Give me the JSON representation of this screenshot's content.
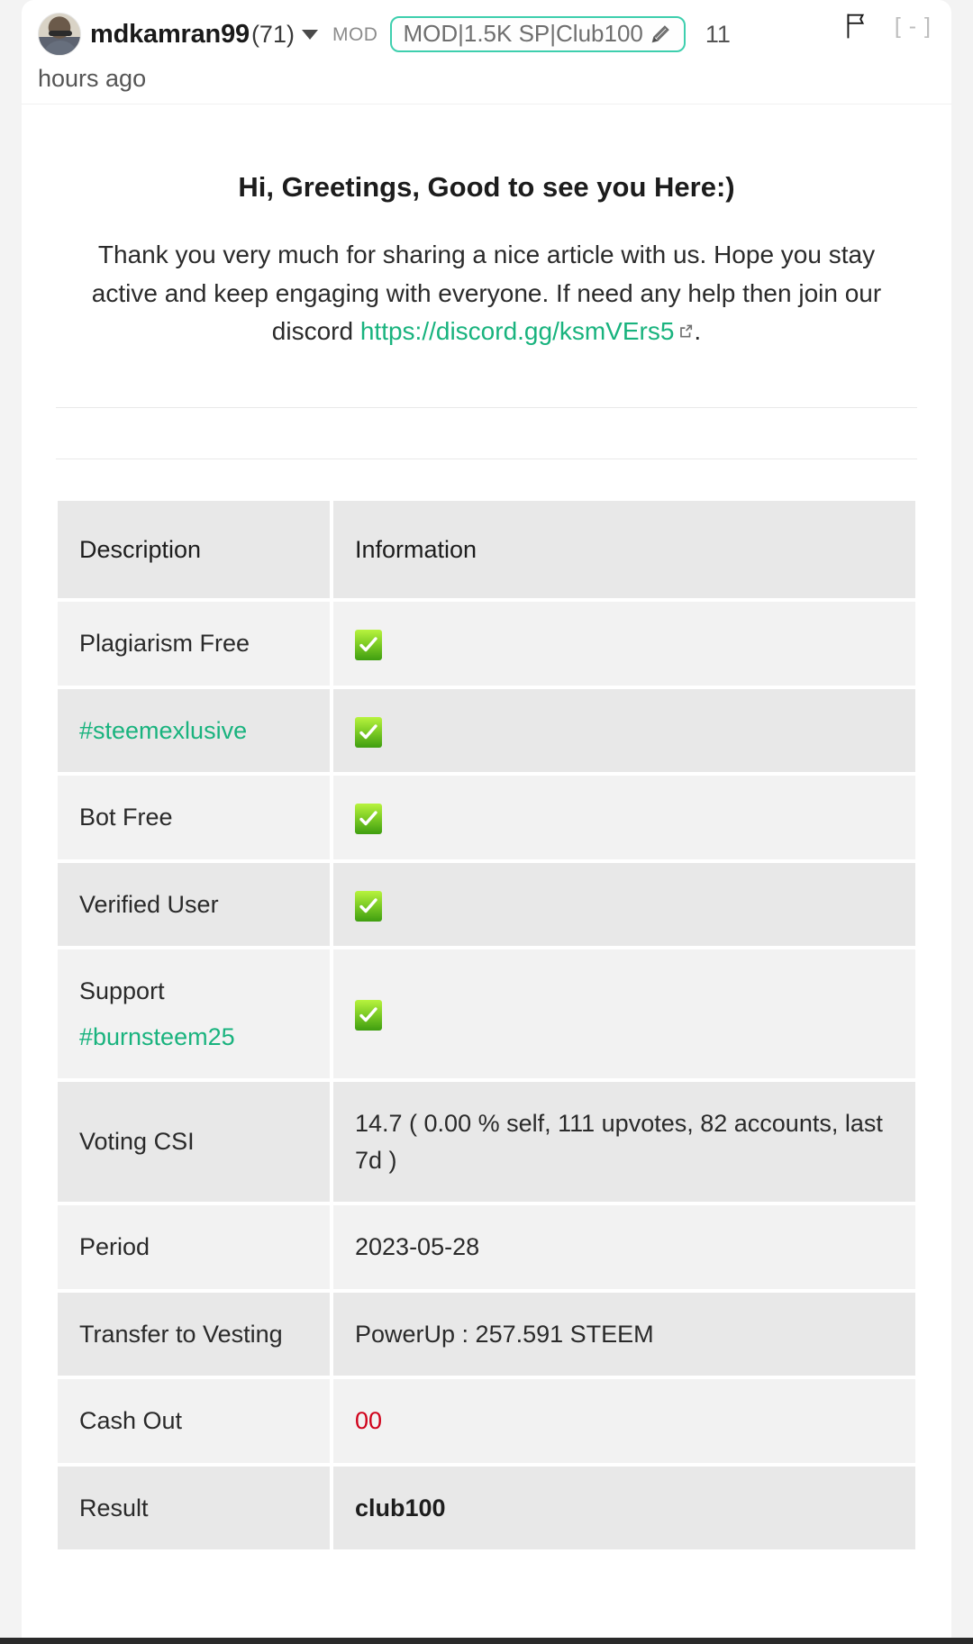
{
  "comment": {
    "author": "mdkamran99",
    "reputation": "(71)",
    "role_label": "MOD",
    "badge_text": "MOD|1.5K SP|Club100",
    "age": "11 hours ago",
    "age_first_part": "11",
    "age_second_part": "hours ago",
    "collapse_toggle": "[ - ]",
    "icons": {
      "caret": "chevron-down-icon",
      "pencil": "pencil-icon",
      "flag": "flag-icon"
    }
  },
  "body": {
    "greeting": "Hi, Greetings, Good to see you Here:)",
    "paragraph_before": "Thank you very much for sharing a nice article with us. Hope you stay active and keep engaging with everyone. If need any help then join our discord ",
    "discord_link": "https://discord.gg/ksmVErs5",
    "paragraph_after": "."
  },
  "table": {
    "headers": [
      "Description",
      "Information"
    ],
    "rows": [
      {
        "description": "Plagiarism Free",
        "type": "check",
        "information": ""
      },
      {
        "description": "#steemexlusive",
        "desc_style": "link",
        "type": "check",
        "information": ""
      },
      {
        "description": "Bot Free",
        "type": "check",
        "information": ""
      },
      {
        "description": "Verified User",
        "type": "check",
        "information": ""
      },
      {
        "description": "Support",
        "description2": "#burnsteem25",
        "desc2_style": "link",
        "type": "check",
        "information": ""
      },
      {
        "description": "Voting CSI",
        "type": "text",
        "information": "14.7 ( 0.00 % self, 111 upvotes, 82 accounts, last 7d )"
      },
      {
        "description": "Period",
        "type": "text",
        "information": "2023-05-28"
      },
      {
        "description": "Transfer to Vesting",
        "type": "text",
        "information": "PowerUp : 257.591 STEEM"
      },
      {
        "description": "Cash Out",
        "type": "text",
        "information": "00",
        "info_style": "red"
      },
      {
        "description": "Result",
        "type": "text",
        "information": "club100",
        "info_style": "bold"
      }
    ]
  },
  "colors": {
    "accent_green": "#19b37e",
    "badge_border": "#3ecfae",
    "check_green": "#5fb90f",
    "danger_red": "#d0021b",
    "row_odd": "#f2f2f2",
    "row_even": "#e8e8e8"
  }
}
